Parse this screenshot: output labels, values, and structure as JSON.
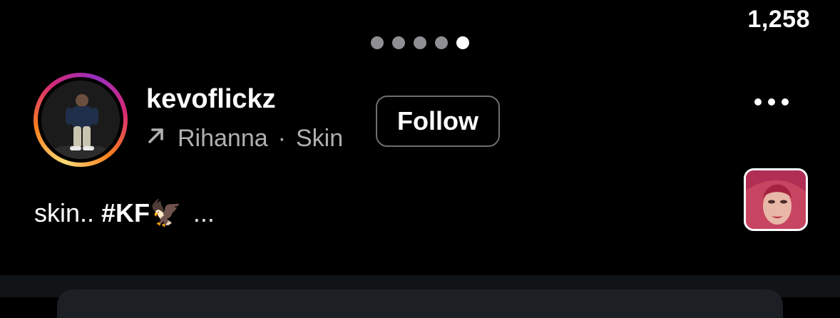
{
  "reel": {
    "view_count": "1,258",
    "carousel": {
      "total": 5,
      "active_index": 4
    }
  },
  "author": {
    "username": "kevoflickz",
    "audio": {
      "artist": "Rihanna",
      "separator": "·",
      "track": "Skin"
    },
    "follow_label": "Follow"
  },
  "caption": {
    "text": "skin..",
    "hashtag": "#KF",
    "emoji": "🦅",
    "more": "..."
  },
  "icons": {
    "more": "more-horizontal-icon",
    "audio": "arrow-up-right-icon",
    "music_thumb": "album-art-thumbnail"
  },
  "colors": {
    "background": "#000000",
    "ring_start": "#feda75",
    "ring_mid": "#d62976",
    "ring_end": "#962fbf",
    "dot_inactive": "#8e8e93",
    "dot_active": "#ffffff",
    "secondary_text": "#b0b0b0"
  }
}
